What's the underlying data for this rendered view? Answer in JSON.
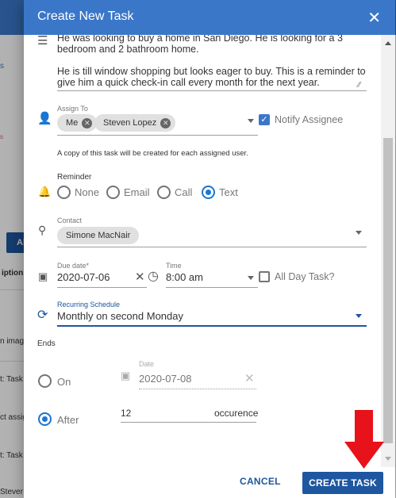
{
  "dialog": {
    "title": "Create New Task",
    "close_glyph": "✕"
  },
  "description": {
    "text": "He was looking to buy a home in San Diego. He is looking for a 3 bedroom and 2 bathroom home.\n\nHe is till window shopping but looks eager to buy. This is a reminder to give him a quick check-in call every month for the next year."
  },
  "assign": {
    "label": "Assign To",
    "chips": [
      "Me",
      "Steven Lopez"
    ],
    "notify_label": "Notify Assignee",
    "notify_checked": true,
    "note": "A copy of this task will be created for each assigned user."
  },
  "reminder": {
    "label": "Reminder",
    "options": [
      "None",
      "Email",
      "Call",
      "Text"
    ],
    "selected": "Text"
  },
  "contact": {
    "label": "Contact",
    "chip": "Simone MacNair"
  },
  "due": {
    "date_label": "Due date*",
    "date_value": "2020-07-06",
    "time_label": "Time",
    "time_value": "8:00 am",
    "all_day_label": "All Day Task?",
    "all_day_checked": false
  },
  "recurring": {
    "label": "Recurring Schedule",
    "value": "Monthly on second Monday"
  },
  "ends": {
    "label": "Ends",
    "on_label": "On",
    "on_date_label": "Date",
    "on_date_value": "2020-07-08",
    "after_label": "After",
    "after_value": "12",
    "after_suffix": "occurence",
    "selected": "After"
  },
  "footer": {
    "cancel": "CANCEL",
    "create": "CREATE TASK"
  },
  "background": {
    "button_label": "Al",
    "snippets": [
      "s",
      "s",
      "iption",
      "n imag",
      "t: Task",
      "ct assig",
      "t: Task",
      "Stever"
    ]
  },
  "colors": {
    "header_blue": "#3a77c9",
    "primary_button": "#1e56a0",
    "annotation_arrow": "#e8121b"
  }
}
